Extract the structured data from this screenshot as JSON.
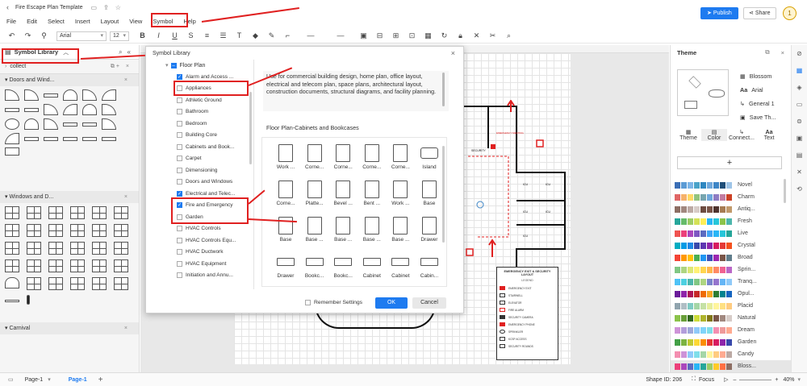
{
  "titlebar": {
    "title": "Fire Escape Plan Template"
  },
  "menu": {
    "items": [
      "File",
      "Edit",
      "Select",
      "Insert",
      "Layout",
      "View",
      "Symbol",
      "Help"
    ]
  },
  "toolbar": {
    "font": "Arial",
    "size": "12"
  },
  "header_right": {
    "publish": "Publish",
    "share": "Share",
    "avatar": "1"
  },
  "left_panel": {
    "title": "Symbol Library",
    "collect": "collect",
    "sections": [
      "Doors and Wind...",
      "Windows and D...",
      "Carnival"
    ]
  },
  "dialog": {
    "title": "Symbol Library",
    "root": "Floor Plan",
    "categories": [
      {
        "label": "Alarm and Access ...",
        "checked": true
      },
      {
        "label": "Appliances",
        "checked": false
      },
      {
        "label": "Athletic Ground",
        "checked": false
      },
      {
        "label": "Bathroom",
        "checked": false
      },
      {
        "label": "Bedroom",
        "checked": false
      },
      {
        "label": "Building Core",
        "checked": false
      },
      {
        "label": "Cabinets and Book...",
        "checked": false
      },
      {
        "label": "Carpet",
        "checked": false
      },
      {
        "label": "Dimensioning",
        "checked": false
      },
      {
        "label": "Doors and Windows",
        "checked": false
      },
      {
        "label": "Electrical and Telec...",
        "checked": true
      },
      {
        "label": "Fire and Emergency",
        "checked": true
      },
      {
        "label": "Garden",
        "checked": false
      },
      {
        "label": "HVAC Controls",
        "checked": false
      },
      {
        "label": "HVAC Controls Equ...",
        "checked": false
      },
      {
        "label": "HVAC Ductwork",
        "checked": false
      },
      {
        "label": "HVAC Equipment",
        "checked": false
      },
      {
        "label": "Initiation and Annu...",
        "checked": false
      }
    ],
    "description": "Use for commercial building design, home plan, office layout, electrical and telecom plan, space plans, architectural layout, construction documents, structural diagrams, and facility planning.",
    "preview_title": "Floor Plan-Cabinets and Bookcases",
    "shapes": [
      [
        "Work ...",
        "Corne...",
        "Corne...",
        "Corne...",
        "Corne...",
        "Island"
      ],
      [
        "Corne...",
        "Platte...",
        "Bevel ...",
        "Bent ...",
        "Work ...",
        "Base"
      ],
      [
        "Base",
        "Base ...",
        "Base ...",
        "Base ...",
        "Base ...",
        "Drawer"
      ],
      [
        "Drawer",
        "Bookc...",
        "Bookc...",
        "Cabinet",
        "Cabinet",
        "Cabin..."
      ]
    ],
    "remember": "Remember Settings",
    "ok": "OK",
    "cancel": "Cancel"
  },
  "legend": {
    "title": "EMERGENCY EXIT & SECURITY LAYOUT",
    "heading": "LEGEND",
    "items": [
      "EMERGENCY EXIT",
      "STAIRWELL",
      "ELEVATOR",
      "FIRE ALARM",
      "SECURITY CAMERA",
      "EMERGENCY PHONE",
      "SPRINKLER",
      "KCSP ACCESS",
      "SECURITY ROUNDS"
    ]
  },
  "floorplan": {
    "security": "SECURITY",
    "assembly": "EMERGENCY MEETING",
    "ids": [
      "ICU",
      "ICU",
      "ICU",
      "ICU",
      "ICU"
    ]
  },
  "right_panel": {
    "title": "Theme",
    "theme_options": [
      "Blossom",
      "Arial",
      "General 1",
      "Save Th..."
    ],
    "tabs": [
      "Theme",
      "Color",
      "Connect...",
      "Text"
    ],
    "palettes": [
      {
        "name": "Novel",
        "colors": [
          "#3b6fb6",
          "#5b9bd5",
          "#7cb5e8",
          "#4aa3c9",
          "#2e86c1",
          "#6fa8dc",
          "#3d85c6",
          "#1f4e79",
          "#9fc5e8"
        ]
      },
      {
        "name": "Charm",
        "colors": [
          "#e06666",
          "#f6b26b",
          "#ffd966",
          "#93c47d",
          "#76a5af",
          "#6fa8dc",
          "#8e7cc3",
          "#c27ba0",
          "#cc4125"
        ]
      },
      {
        "name": "Antiq...",
        "colors": [
          "#8d6e63",
          "#a1887f",
          "#bcaaa4",
          "#d7ccc8",
          "#6d4c41",
          "#795548",
          "#4e342e",
          "#a67c52",
          "#c19a6b"
        ]
      },
      {
        "name": "Fresh",
        "colors": [
          "#26a69a",
          "#66bb6a",
          "#9ccc65",
          "#d4e157",
          "#ffee58",
          "#29b6f6",
          "#26c6da",
          "#8bc34a",
          "#4db6ac"
        ]
      },
      {
        "name": "Live",
        "colors": [
          "#ef5350",
          "#ec407a",
          "#ab47bc",
          "#7e57c2",
          "#5c6bc0",
          "#42a5f5",
          "#29b6f6",
          "#26c6da",
          "#26a69a"
        ]
      },
      {
        "name": "Crystal",
        "colors": [
          "#00acc1",
          "#039be5",
          "#1e88e5",
          "#3949ab",
          "#5e35b1",
          "#8e24aa",
          "#d81b60",
          "#e53935",
          "#f4511e"
        ]
      },
      {
        "name": "Broad",
        "colors": [
          "#f44336",
          "#ff9800",
          "#ffc107",
          "#4caf50",
          "#2196f3",
          "#3f51b5",
          "#9c27b0",
          "#795548",
          "#607d8b"
        ]
      },
      {
        "name": "Sprin...",
        "colors": [
          "#81c784",
          "#aed581",
          "#dce775",
          "#fff176",
          "#ffd54f",
          "#ffb74d",
          "#ff8a65",
          "#f06292",
          "#ba68c8"
        ]
      },
      {
        "name": "Tranq...",
        "colors": [
          "#4fc3f7",
          "#4dd0e1",
          "#4db6ac",
          "#81c784",
          "#aed581",
          "#7986cb",
          "#9575cd",
          "#64b5f6",
          "#90caf9"
        ]
      },
      {
        "name": "Opul...",
        "colors": [
          "#6a1b9a",
          "#8e24aa",
          "#ad1457",
          "#c62828",
          "#ef6c00",
          "#f9a825",
          "#2e7d32",
          "#00838f",
          "#1565c0"
        ]
      },
      {
        "name": "Placid",
        "colors": [
          "#90a4ae",
          "#b0bec5",
          "#80cbc4",
          "#a5d6a7",
          "#c5e1a5",
          "#e6ee9c",
          "#fff59d",
          "#ffe082",
          "#ffcc80"
        ]
      },
      {
        "name": "Natural",
        "colors": [
          "#8bc34a",
          "#689f38",
          "#33691e",
          "#cddc39",
          "#afb42b",
          "#827717",
          "#795548",
          "#a1887f",
          "#d7ccc8"
        ]
      },
      {
        "name": "Dream",
        "colors": [
          "#ce93d8",
          "#b39ddb",
          "#9fa8da",
          "#90caf9",
          "#81d4fa",
          "#80deea",
          "#f48fb1",
          "#ef9a9a",
          "#ffab91"
        ]
      },
      {
        "name": "Garden",
        "colors": [
          "#43a047",
          "#7cb342",
          "#c0ca33",
          "#fdd835",
          "#fb8c00",
          "#e53935",
          "#d81b60",
          "#8e24aa",
          "#3949ab"
        ]
      },
      {
        "name": "Candy",
        "colors": [
          "#f48fb1",
          "#ce93d8",
          "#90caf9",
          "#80deea",
          "#a5d6a7",
          "#fff59d",
          "#ffcc80",
          "#ffab91",
          "#bcaaa4"
        ]
      },
      {
        "name": "Bloss...",
        "colors": [
          "#ec407a",
          "#ab47bc",
          "#5c6bc0",
          "#29b6f6",
          "#26a69a",
          "#9ccc65",
          "#ffca28",
          "#ff7043",
          "#8d6e63"
        ]
      }
    ]
  },
  "statusbar": {
    "page_tab": "Page-1",
    "page_active": "Page-1",
    "shape_id": "Shape ID: 206",
    "focus": "Focus",
    "zoom": "40%"
  }
}
